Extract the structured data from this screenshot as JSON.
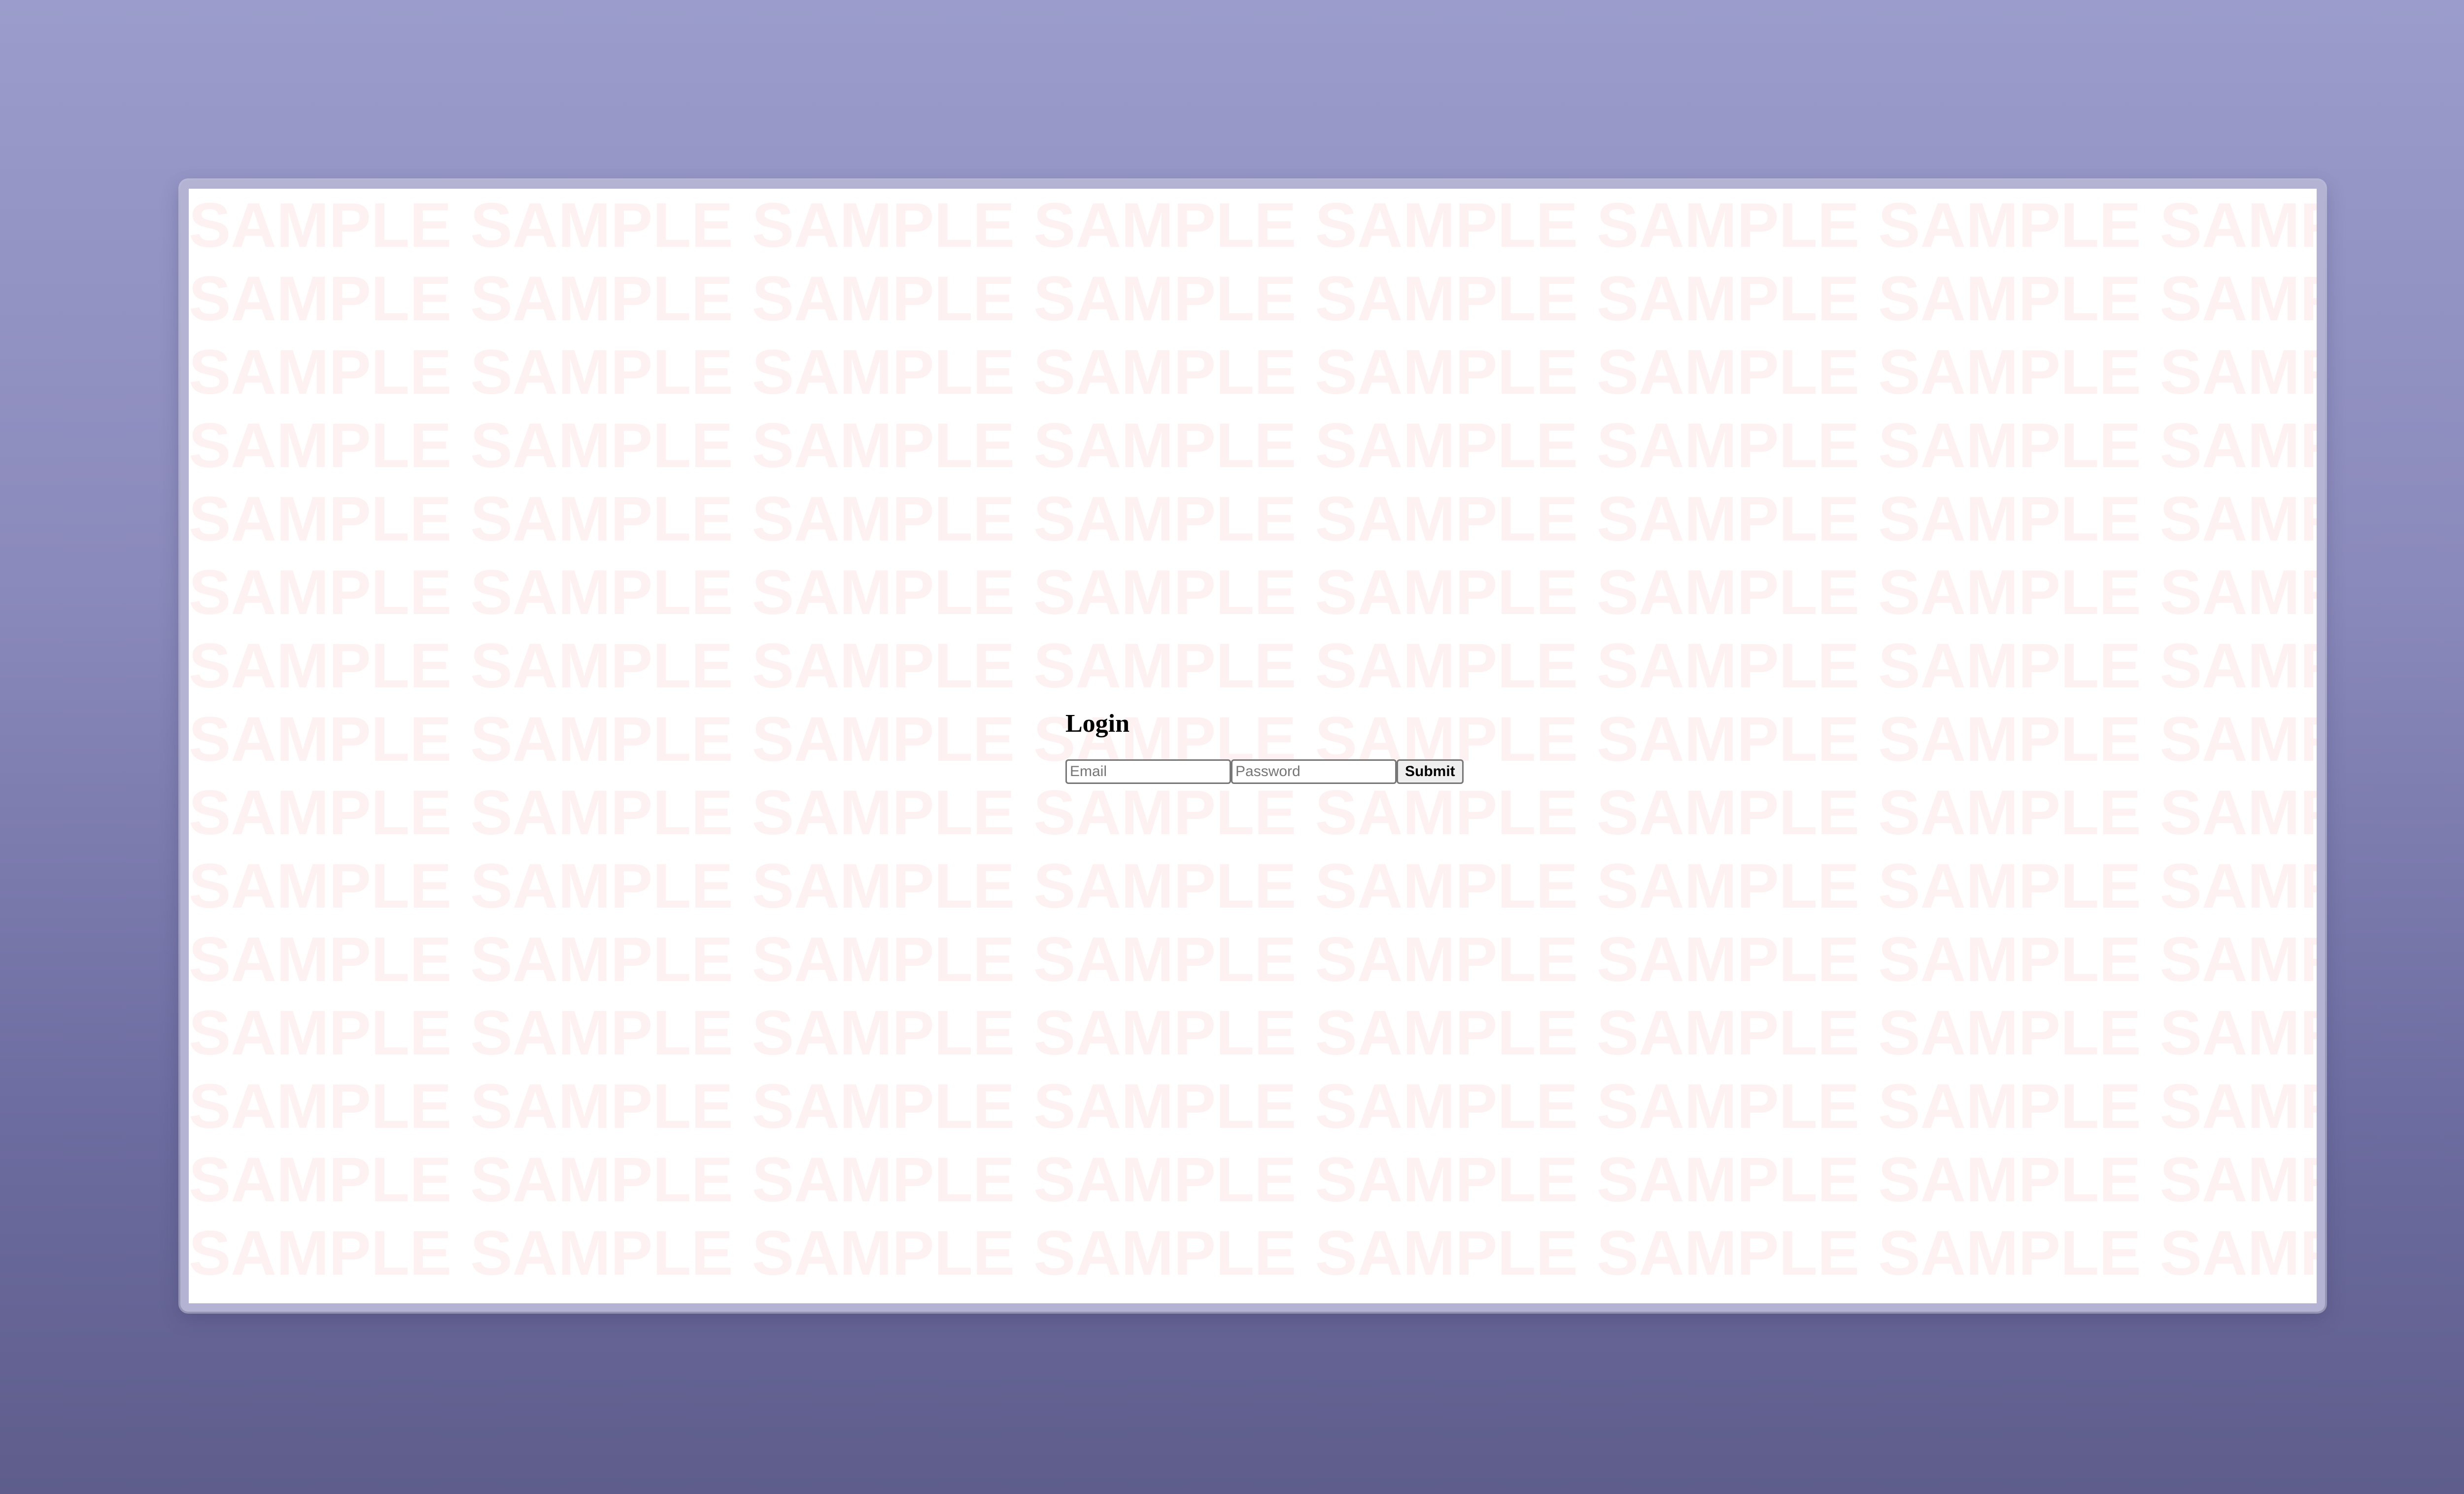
{
  "watermark": {
    "text": "SAMPLE"
  },
  "login": {
    "title": "Login",
    "email_placeholder": "Email",
    "email_value": "",
    "password_placeholder": "Password",
    "password_value": "",
    "submit_label": "Submit"
  },
  "colors": {
    "background_top": "#9b9ccb",
    "background_bottom": "#5e5d8b",
    "frame": "#b4b3d3",
    "watermark": "#fdf1f1"
  }
}
